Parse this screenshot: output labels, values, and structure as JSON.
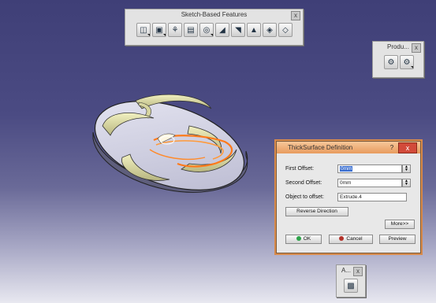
{
  "toolbars": {
    "sketch": {
      "title": "Sketch-Based Features",
      "close": "x",
      "icons": [
        "pad-icon",
        "pocket-icon",
        "shaft-icon",
        "groove-icon",
        "hole-icon",
        "rib-icon",
        "slot-icon",
        "stiffener-icon",
        "multi-section-solid-icon",
        "removed-multi-section-icon"
      ]
    },
    "product": {
      "title": "Produ...",
      "close": "x",
      "icons": [
        "product-gear-icon",
        "product-gear2-icon"
      ]
    },
    "apply": {
      "title": "A...",
      "close": "x",
      "icons": [
        "apply-material-icon"
      ]
    }
  },
  "dialog": {
    "title": "ThickSurface Definition",
    "help": "?",
    "close": "x",
    "first_offset_label": "First Offset:",
    "first_offset_value": "0mm",
    "second_offset_label": "Second Offset:",
    "second_offset_value": "0mm",
    "object_label": "Object to offset:",
    "object_value": "Extrude.4",
    "reverse_button": "Reverse Direction",
    "more_button": "More>>",
    "ok_button": "OK",
    "cancel_button": "Cancel",
    "preview_button": "Preview",
    "ok_color": "#2ea34a",
    "cancel_color": "#b3322a"
  }
}
